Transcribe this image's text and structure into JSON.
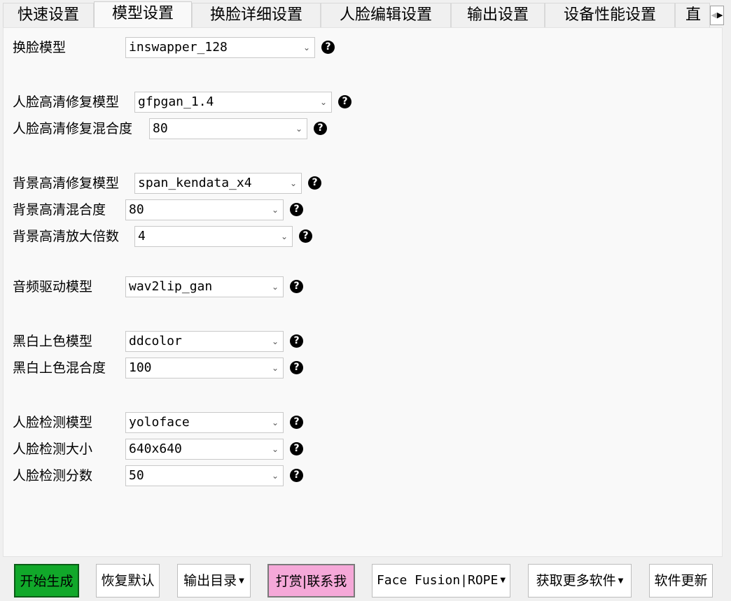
{
  "tabs": [
    {
      "label": "快速设置",
      "active": false
    },
    {
      "label": "模型设置",
      "active": true
    },
    {
      "label": "换脸详细设置",
      "active": false
    },
    {
      "label": "人脸编辑设置",
      "active": false
    },
    {
      "label": "输出设置",
      "active": false
    },
    {
      "label": "设备性能设置",
      "active": false
    },
    {
      "label": "直",
      "active": false
    }
  ],
  "tab_scroll": {
    "left": "◀",
    "right": "▶"
  },
  "help_glyph": "?",
  "chevron_glyph": "⌄",
  "settings": {
    "face_swapper_model": {
      "label": "换脸模型",
      "value": "inswapper_128"
    },
    "face_enhancer_model": {
      "label": "人脸高清修复模型",
      "value": "gfpgan_1.4"
    },
    "face_enhancer_blend": {
      "label": "人脸高清修复混合度",
      "value": "80"
    },
    "frame_enhancer_model": {
      "label": "背景高清修复模型",
      "value": "span_kendata_x4"
    },
    "frame_enhancer_blend": {
      "label": "背景高清混合度",
      "value": "80"
    },
    "frame_enhancer_scale": {
      "label": "背景高清放大倍数",
      "value": "4"
    },
    "lip_sync_model": {
      "label": "音频驱动模型",
      "value": "wav2lip_gan"
    },
    "colorizer_model": {
      "label": "黑白上色模型",
      "value": "ddcolor"
    },
    "colorizer_blend": {
      "label": "黑白上色混合度",
      "value": "100"
    },
    "face_detector_model": {
      "label": "人脸检测模型",
      "value": "yoloface"
    },
    "face_detector_size": {
      "label": "人脸检测大小",
      "value": "640x640"
    },
    "face_detector_score": {
      "label": "人脸检测分数",
      "value": "50"
    }
  },
  "buttons": {
    "start": "开始生成",
    "reset": "恢复默认",
    "output_dir": "输出目录",
    "donate": "打赏|联系我",
    "face_fusion": "Face Fusion|ROPE",
    "more_software": "获取更多软件",
    "update": "软件更新"
  },
  "colors": {
    "start_button": "#11a82a",
    "donate_button": "#f5a8d8",
    "panel": "#f9f9f9"
  }
}
